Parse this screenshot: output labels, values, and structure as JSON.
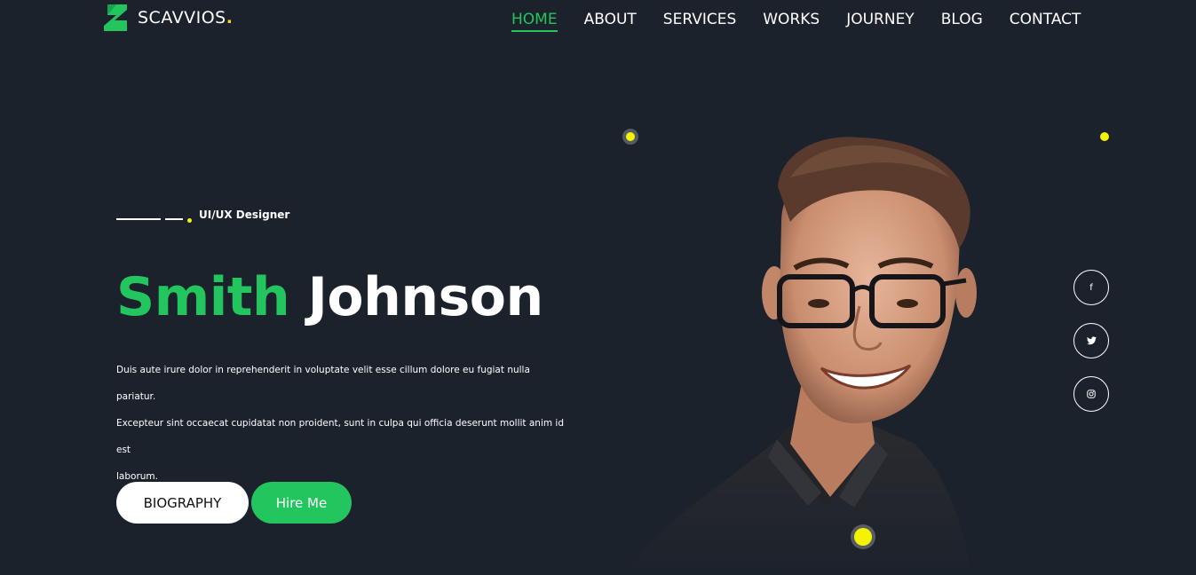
{
  "brand": {
    "name": "SCAVVIOS",
    "dot": ".",
    "accent": "#22c55e",
    "highlight": "#f4d22e"
  },
  "nav": [
    {
      "label": "HOME",
      "active": true
    },
    {
      "label": "ABOUT"
    },
    {
      "label": "SERVICES"
    },
    {
      "label": "WORKS"
    },
    {
      "label": "JOURNEY"
    },
    {
      "label": "BLOG"
    },
    {
      "label": "CONTACT"
    }
  ],
  "hero": {
    "subtitle": "UI/UX Designer",
    "first_name": "Smith",
    "last_name": "Johnson",
    "description_lines": [
      "Duis aute irure dolor in reprehenderit in voluptate velit esse cillum dolore eu fugiat nulla pariatur.",
      "Excepteur sint occaecat cupidatat non proident, sunt in culpa qui officia deserunt mollit anim id est",
      "laborum."
    ],
    "biography_label": "BIOGRAPHY",
    "hire_label": "Hire Me"
  },
  "socials": [
    {
      "icon": "facebook-icon",
      "glyph": "f"
    },
    {
      "icon": "twitter-icon",
      "glyph": "🐦"
    },
    {
      "icon": "instagram-icon",
      "glyph": "◎"
    }
  ],
  "colors": {
    "background": "#1c222c",
    "dot": "#f4f400",
    "button_light": "#ffffff"
  }
}
